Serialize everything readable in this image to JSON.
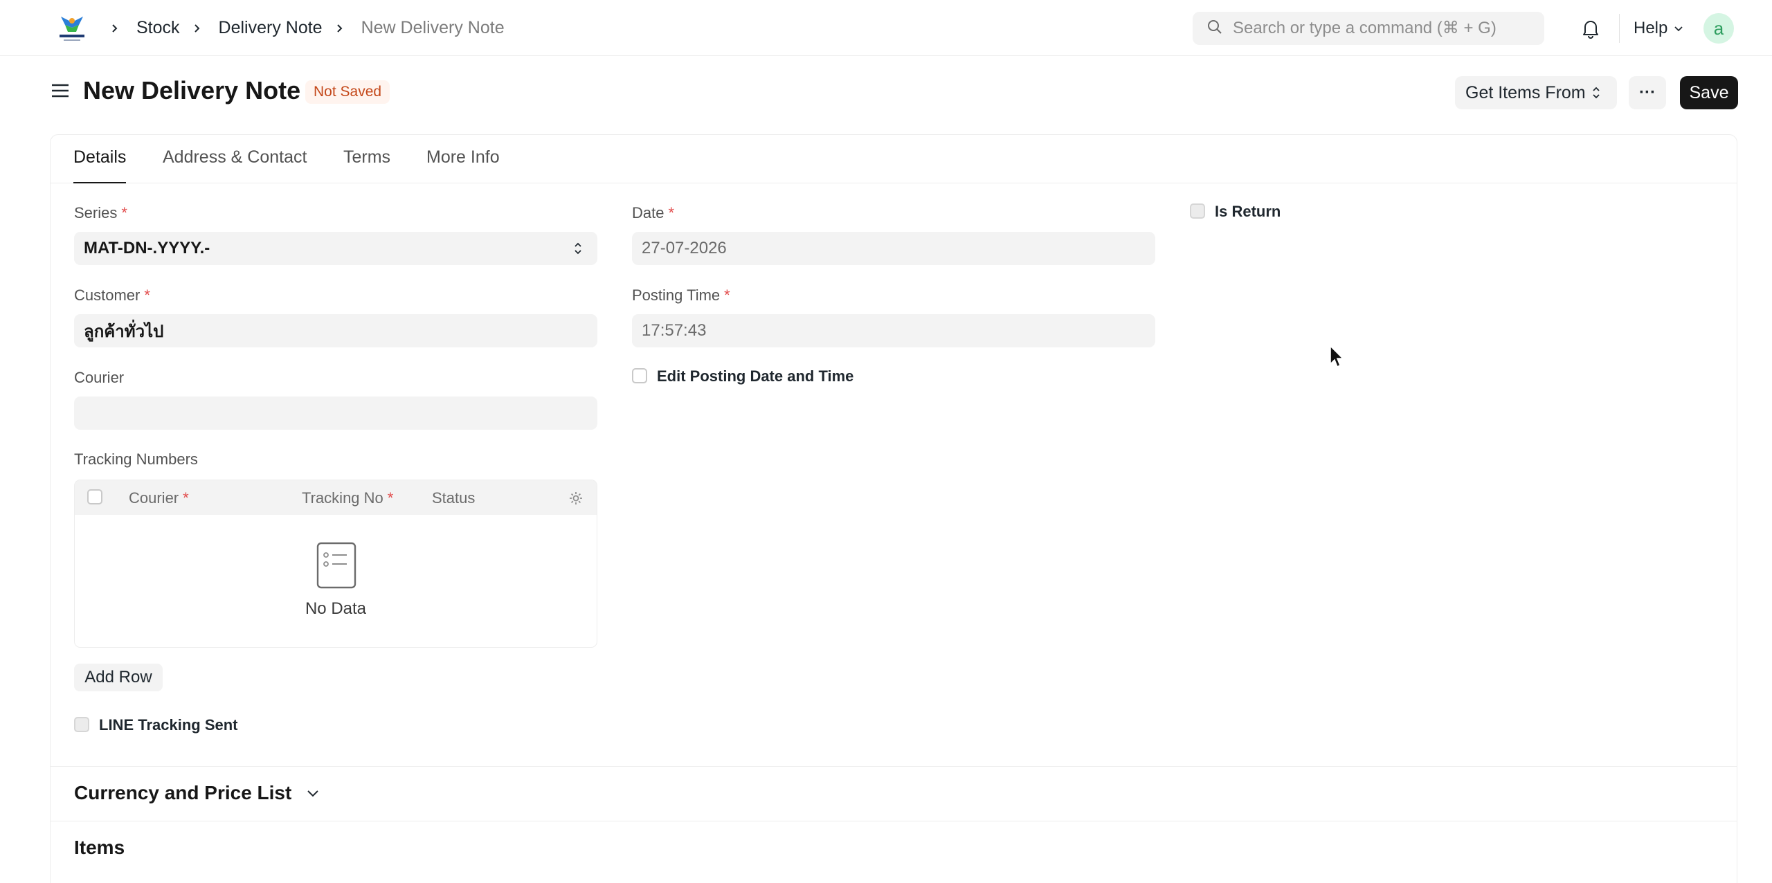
{
  "navbar": {
    "breadcrumbs": [
      "Stock",
      "Delivery Note",
      "New Delivery Note"
    ],
    "search_placeholder": "Search or type a command (⌘ + G)",
    "help_label": "Help",
    "avatar_letter": "a"
  },
  "page": {
    "title": "New Delivery Note",
    "status": "Not Saved",
    "get_items_label": "Get Items From",
    "more_label": "···",
    "save_label": "Save"
  },
  "tabs": [
    "Details",
    "Address & Contact",
    "Terms",
    "More Info"
  ],
  "form": {
    "series_label": "Series",
    "series_value": "MAT-DN-.YYYY.-",
    "date_label": "Date",
    "date_value": "27-07-2026",
    "is_return_label": "Is Return",
    "customer_label": "Customer",
    "customer_value": "ลูกค้าทั่วไป",
    "posting_time_label": "Posting Time",
    "posting_time_value": "17:57:43",
    "edit_posting_label": "Edit Posting Date and Time",
    "courier_label": "Courier",
    "courier_value": "",
    "tracking_label": "Tracking Numbers",
    "tracking_columns": [
      "Courier",
      "Tracking No",
      "Status"
    ],
    "tracking_empty": "No Data",
    "add_row_label": "Add Row",
    "line_tracking_label": "LINE Tracking Sent"
  },
  "sections": {
    "currency": "Currency and Price List",
    "items": "Items"
  },
  "colors": {
    "required": "#e24c4c",
    "status_text": "#c4481a",
    "status_bg": "#fff4ef",
    "primary_button": "#171717"
  }
}
